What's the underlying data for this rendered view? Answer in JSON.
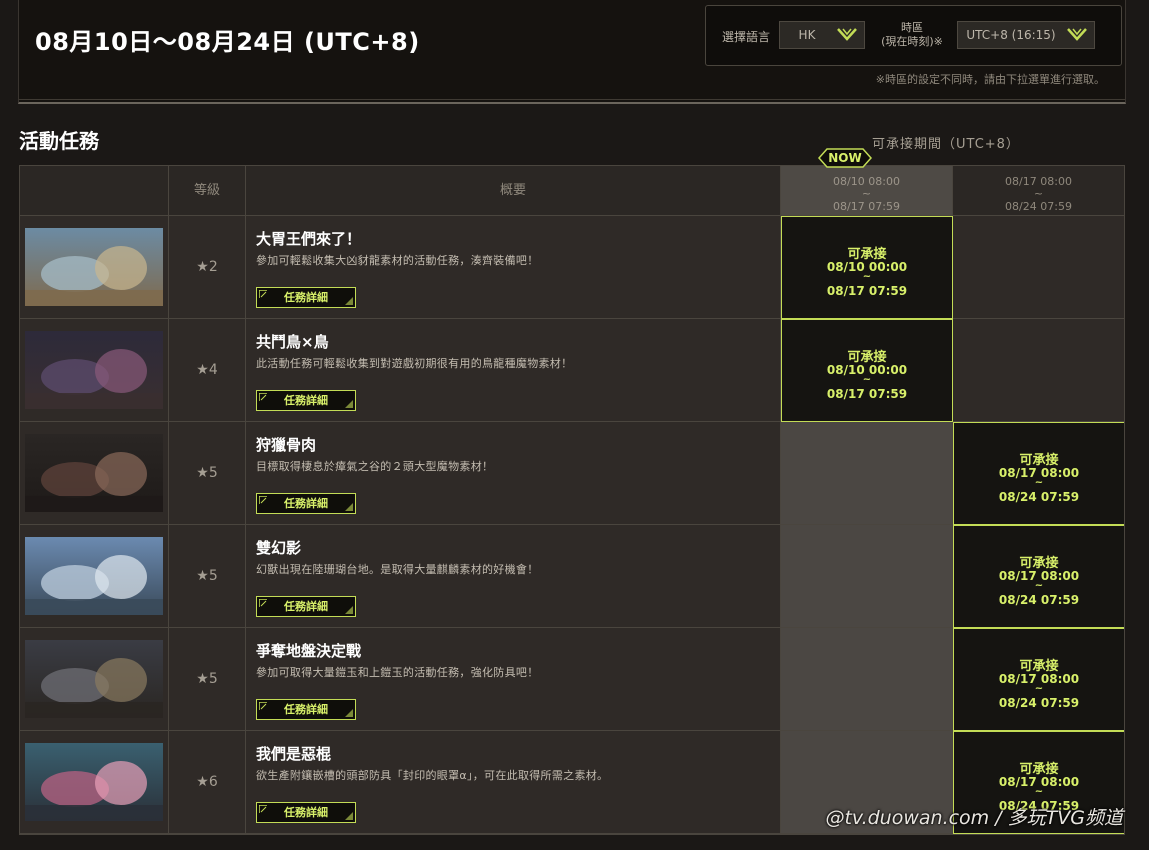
{
  "header": {
    "date_range": "08月10日～08月24日 (UTC+8)",
    "language_label": "選擇語言",
    "language_value": "HK",
    "timezone_label_line1": "時區",
    "timezone_label_line2": "(現在時刻)※",
    "timezone_value": "UTC+8 (16:15)",
    "timezone_note": "※時區的設定不同時，請由下拉選單進行選取。"
  },
  "section": {
    "title": "活動任務",
    "period_label": "可承接期間（UTC+8）",
    "now_badge": "NOW"
  },
  "table": {
    "columns": {
      "level": "等級",
      "summary": "概要",
      "period1_line1": "08/10 08:00",
      "period1_tilde": "~",
      "period1_line2": "08/17 07:59",
      "period2_line1": "08/17 08:00",
      "period2_tilde": "~",
      "period2_line2": "08/24 07:59"
    },
    "detail_button_label": "任務詳細",
    "quests": [
      {
        "stars": "★2",
        "title": "大胃王們來了！",
        "description": "參加可輕鬆收集大凶豺龍素材的活動任務，湊齊裝備吧！",
        "available_period": 1,
        "avail_label": "可承接",
        "avail_start": "08/10 00:00",
        "avail_tilde": "~",
        "avail_end": "08/17 07:59"
      },
      {
        "stars": "★4",
        "title": "共鬥鳥×鳥",
        "description": "此活動任務可輕鬆收集到對遊戲初期很有用的鳥龍種魔物素材！",
        "available_period": 1,
        "avail_label": "可承接",
        "avail_start": "08/10 00:00",
        "avail_tilde": "~",
        "avail_end": "08/17 07:59"
      },
      {
        "stars": "★5",
        "title": "狩獵骨肉",
        "description": "目標取得棲息於瘴氣之谷的２頭大型魔物素材！",
        "available_period": 2,
        "avail_label": "可承接",
        "avail_start": "08/17 08:00",
        "avail_tilde": "~",
        "avail_end": "08/24 07:59"
      },
      {
        "stars": "★5",
        "title": "雙幻影",
        "description": "幻獸出現在陸珊瑚台地。是取得大量麒麟素材的好機會！",
        "available_period": 2,
        "avail_label": "可承接",
        "avail_start": "08/17 08:00",
        "avail_tilde": "~",
        "avail_end": "08/24 07:59"
      },
      {
        "stars": "★5",
        "title": "爭奪地盤決定戰",
        "description": "參加可取得大量鎧玉和上鎧玉的活動任務，強化防具吧！",
        "available_period": 2,
        "avail_label": "可承接",
        "avail_start": "08/17 08:00",
        "avail_tilde": "~",
        "avail_end": "08/24 07:59"
      },
      {
        "stars": "★6",
        "title": "我們是惡棍",
        "description": "欲生產附鑲嵌槽的頭部防具「封印的眼罩α」，可在此取得所需之素材。",
        "available_period": 2,
        "avail_label": "可承接",
        "avail_start": "08/17 08:00",
        "avail_tilde": "~",
        "avail_end": "08/24 07:59"
      }
    ]
  },
  "watermark": "@tv.duowan.com / 多玩TVG频道",
  "colors": {
    "accent": "#d8f06a",
    "accent_border": "#c3dc56",
    "background": "#1b1816",
    "row_background": "#2f2a27",
    "now_column": "#4b4743"
  }
}
